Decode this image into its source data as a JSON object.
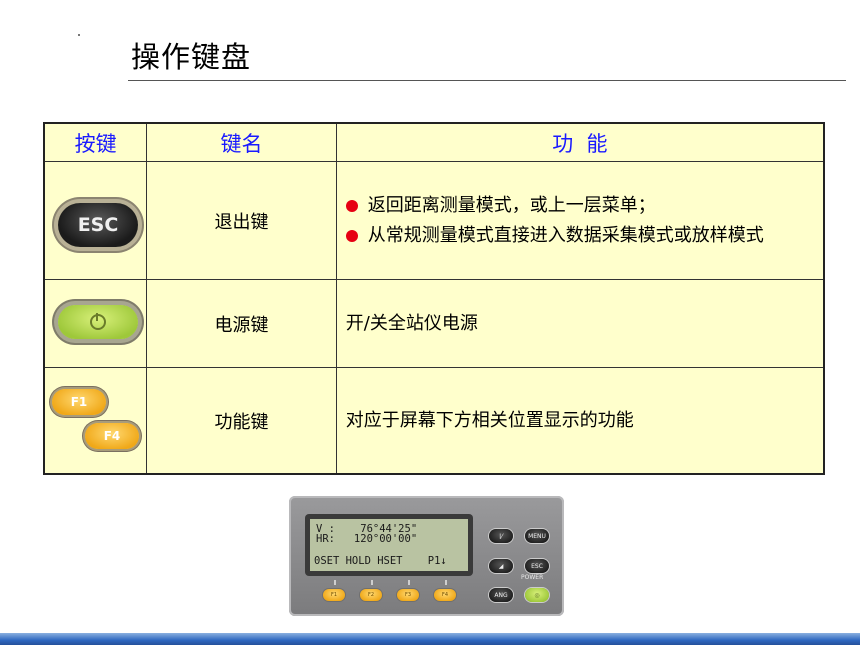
{
  "slide": {
    "title": "操作键盘"
  },
  "table": {
    "headers": [
      "按键",
      "键名",
      "功  能"
    ],
    "rows": [
      {
        "key_icon": "esc-key-icon",
        "key_label": "ESC",
        "name": "退出键",
        "functions": [
          "返回距离测量模式，或上一层菜单；",
          "从常规测量模式直接进入数据采集模式或放样模式"
        ]
      },
      {
        "key_icon": "power-key-icon",
        "name": "电源键",
        "function_text": "开/关全站仪电源"
      },
      {
        "key_icon": "function-key-icons",
        "key_labels": [
          "F1",
          "F4"
        ],
        "name": "功能键",
        "function_text": "对应于屏幕下方相关位置显示的功能"
      }
    ]
  },
  "instrument": {
    "screen": {
      "line1": "V :    76°44'25\"",
      "line2": "HR:   120°00'00\"",
      "line3": "0SET HOLD HSET    P1↓"
    },
    "f_buttons": [
      "F1",
      "F2",
      "F3",
      "F4"
    ],
    "right_buttons": [
      "MENU",
      "ESC",
      "ANG"
    ],
    "power_label": "POWER"
  },
  "colors": {
    "table_bg": "#ffffcc",
    "header_text": "#1a1aff",
    "bullet": "#e60012",
    "bottom_bar": "#2f68c0"
  }
}
